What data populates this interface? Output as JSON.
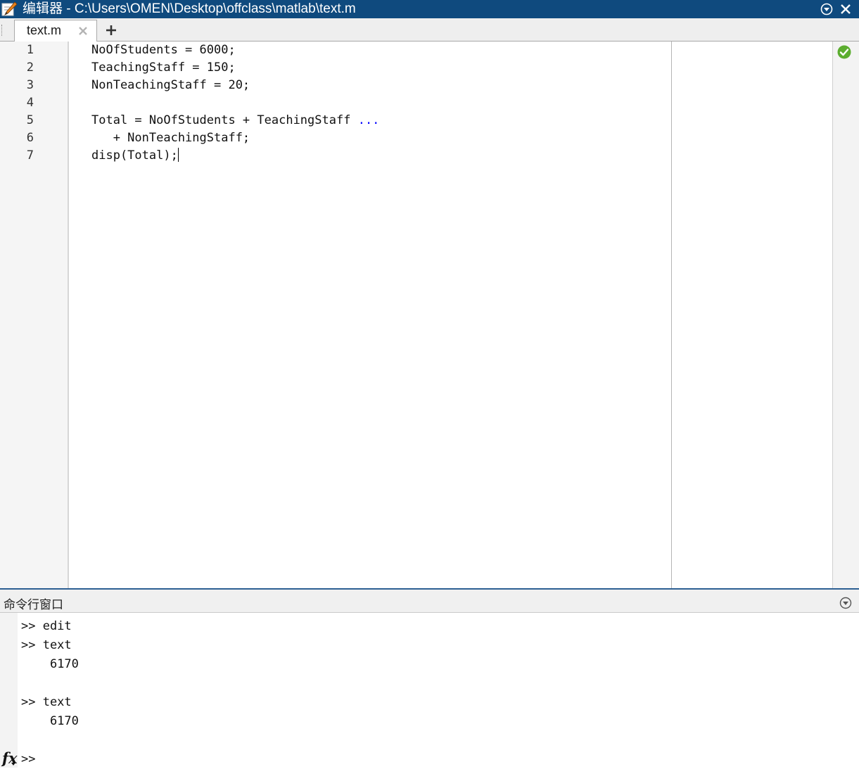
{
  "titlebar": {
    "title": "编辑器 - C:\\Users\\OMEN\\Desktop\\offclass\\matlab\\text.m",
    "icons": [
      "editor-pencil-icon",
      "panel-menu-icon",
      "close-icon"
    ],
    "background": "#0f4a7e"
  },
  "tabs": [
    {
      "label": "text.m",
      "active": true
    }
  ],
  "editor": {
    "line_numbers": [
      "1",
      "2",
      "3",
      "4",
      "5",
      "6",
      "7"
    ],
    "lines": [
      {
        "text": "NoOfStudents = 6000;",
        "continuation": ""
      },
      {
        "text": "TeachingStaff = 150;",
        "continuation": ""
      },
      {
        "text": "NonTeachingStaff = 20;",
        "continuation": ""
      },
      {
        "text": "",
        "continuation": ""
      },
      {
        "text": "Total = NoOfStudents + TeachingStaff ",
        "continuation": "..."
      },
      {
        "text": "   + NonTeachingStaff;",
        "continuation": ""
      },
      {
        "text": "disp(Total);",
        "continuation": ""
      }
    ],
    "caret_line": 7,
    "status": "no-issues",
    "status_color": "#5bad2f"
  },
  "command_window": {
    "title": "命令行窗口",
    "lines": [
      ">> edit",
      ">> text",
      "    6170",
      "",
      ">> text",
      "    6170",
      ""
    ],
    "prompt": ">>",
    "fx_label": "fx"
  }
}
